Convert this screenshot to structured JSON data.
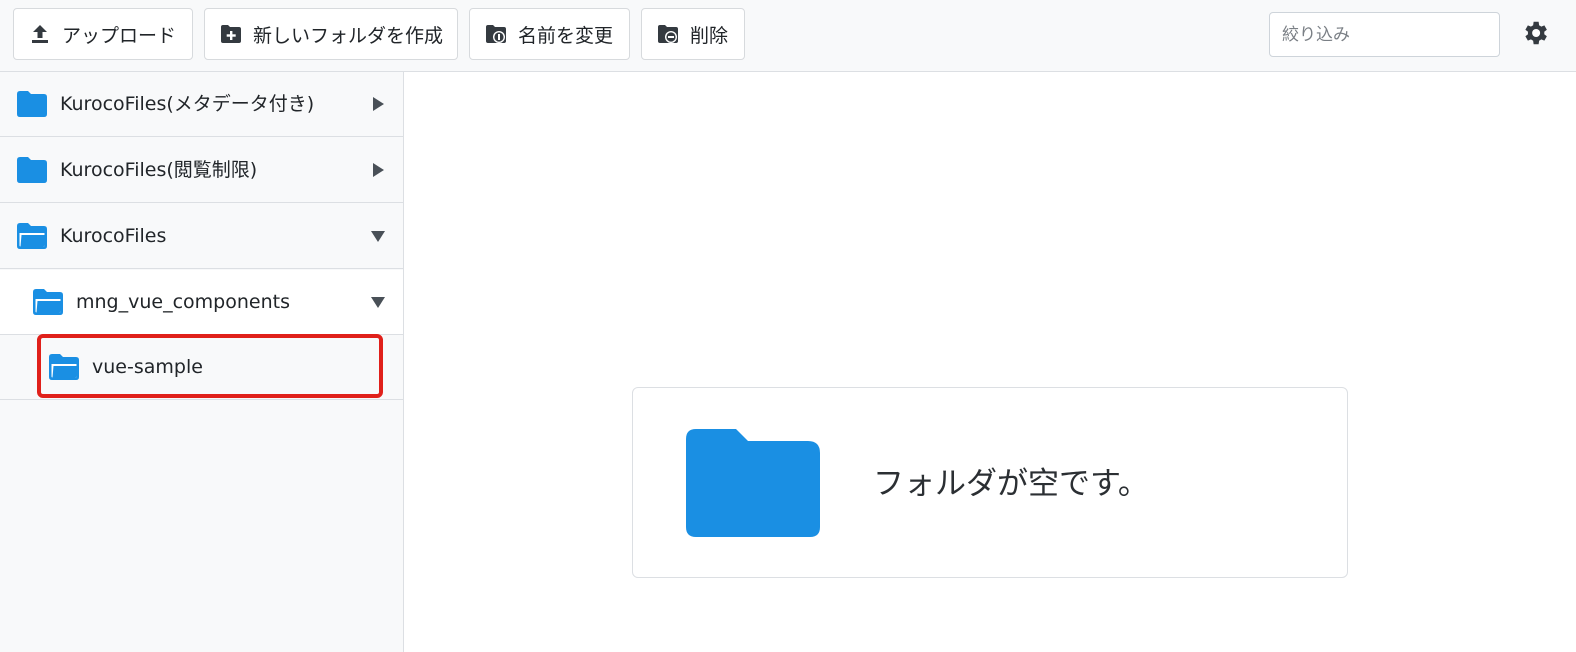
{
  "toolbar": {
    "upload_label": "アップロード",
    "new_folder_label": "新しいフォルダを作成",
    "rename_label": "名前を変更",
    "delete_label": "削除",
    "filter_placeholder": "絞り込み",
    "settings_icon": "gear-icon"
  },
  "sidebar": {
    "items": [
      {
        "label": "KurocoFiles(メタデータ付き)",
        "icon": "folder-closed-icon",
        "caret": "right"
      },
      {
        "label": "KurocoFiles(閲覧制限)",
        "icon": "folder-closed-icon",
        "caret": "right"
      },
      {
        "label": "KurocoFiles",
        "icon": "folder-open-icon",
        "caret": "down"
      },
      {
        "label": "mng_vue_components",
        "icon": "folder-open-icon",
        "caret": "down"
      },
      {
        "label": "vue-sample",
        "icon": "folder-open-icon",
        "selected": true
      }
    ]
  },
  "main": {
    "empty_message": "フォルダが空です。"
  },
  "colors": {
    "accent": "#1a8fe3",
    "highlight": "#e0201a",
    "toolbar_bg": "#f8f9fa"
  }
}
